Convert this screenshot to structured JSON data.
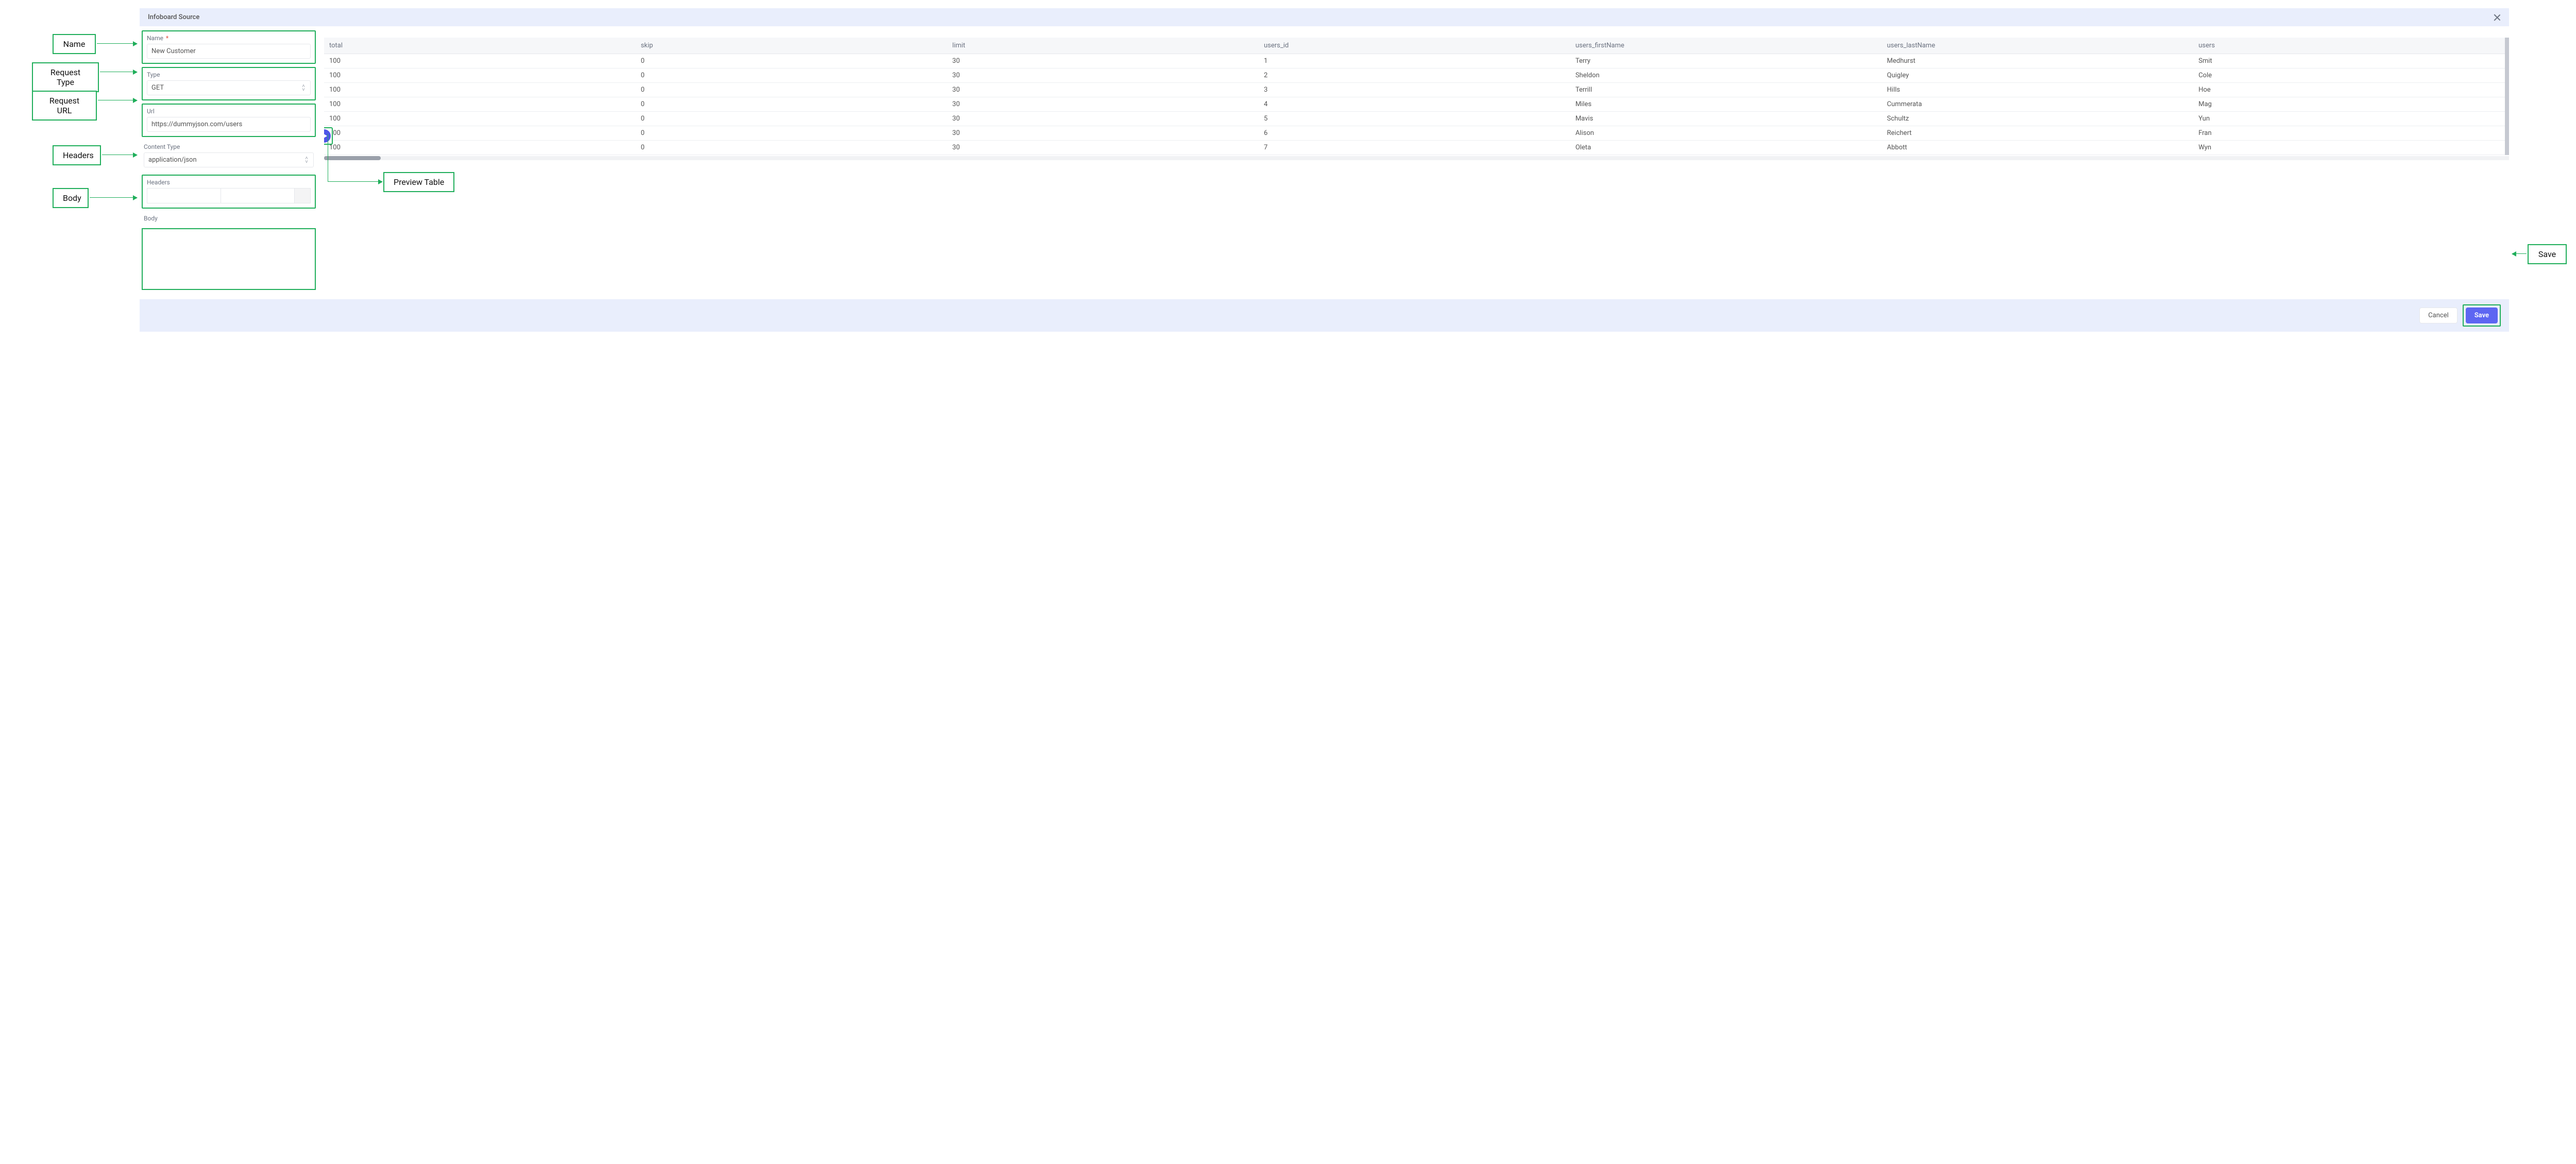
{
  "modal": {
    "title": "Infoboard Source",
    "name_label": "Name",
    "name_value": "New Customer",
    "type_label": "Type",
    "type_value": "GET",
    "url_label": "Url",
    "url_value": "https://dummyjson.com/users",
    "content_type_label": "Content Type",
    "content_type_value": "application/json",
    "headers_label": "Headers",
    "body_label": "Body",
    "cancel_label": "Cancel",
    "save_label": "Save"
  },
  "table": {
    "columns": [
      "total",
      "skip",
      "limit",
      "users_id",
      "users_firstName",
      "users_lastName",
      "users"
    ],
    "rows": [
      {
        "c": [
          "100",
          "0",
          "30",
          "1",
          "Terry",
          "Medhurst",
          "Smit"
        ]
      },
      {
        "c": [
          "100",
          "0",
          "30",
          "2",
          "Sheldon",
          "Quigley",
          "Cole"
        ]
      },
      {
        "c": [
          "100",
          "0",
          "30",
          "3",
          "Terrill",
          "Hills",
          "Hoe"
        ]
      },
      {
        "c": [
          "100",
          "0",
          "30",
          "4",
          "Miles",
          "Cummerata",
          "Mag"
        ]
      },
      {
        "c": [
          "100",
          "0",
          "30",
          "5",
          "Mavis",
          "Schultz",
          "Yun"
        ]
      },
      {
        "c": [
          "100",
          "0",
          "30",
          "6",
          "Alison",
          "Reichert",
          "Fran"
        ]
      },
      {
        "c": [
          "100",
          "0",
          "30",
          "7",
          "Oleta",
          "Abbott",
          "Wyn"
        ]
      }
    ]
  },
  "callouts": {
    "name": "Name",
    "request_type": "Request Type",
    "request_url": "Request URL",
    "headers": "Headers",
    "body": "Body",
    "preview_table": "Preview Table",
    "save": "Save"
  }
}
